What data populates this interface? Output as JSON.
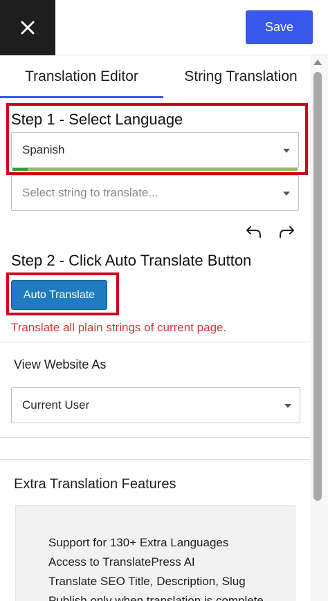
{
  "topbar": {
    "save_label": "Save"
  },
  "tabs": [
    {
      "label": "Translation Editor",
      "active": true
    },
    {
      "label": "String Translation",
      "active": false
    }
  ],
  "step1": {
    "title": "Step 1 - Select Language",
    "language_value": "Spanish",
    "string_placeholder": "Select string to translate..."
  },
  "step2": {
    "title": "Step 2 - Click Auto Translate Button",
    "button_label": "Auto Translate",
    "hint": "Translate all plain strings of current page."
  },
  "view_as": {
    "label": "View Website As",
    "value": "Current User"
  },
  "extra": {
    "title": "Extra Translation Features",
    "items": [
      "Support for 130+ Extra Languages",
      "Access to TranslatePress AI",
      "Translate SEO Title, Description, Slug",
      "Publish only when translation is complete"
    ]
  },
  "colors": {
    "accent": "#3858e9",
    "highlight": "#d0021b",
    "auto_button": "#1e7cc0",
    "hint": "#d63638"
  }
}
